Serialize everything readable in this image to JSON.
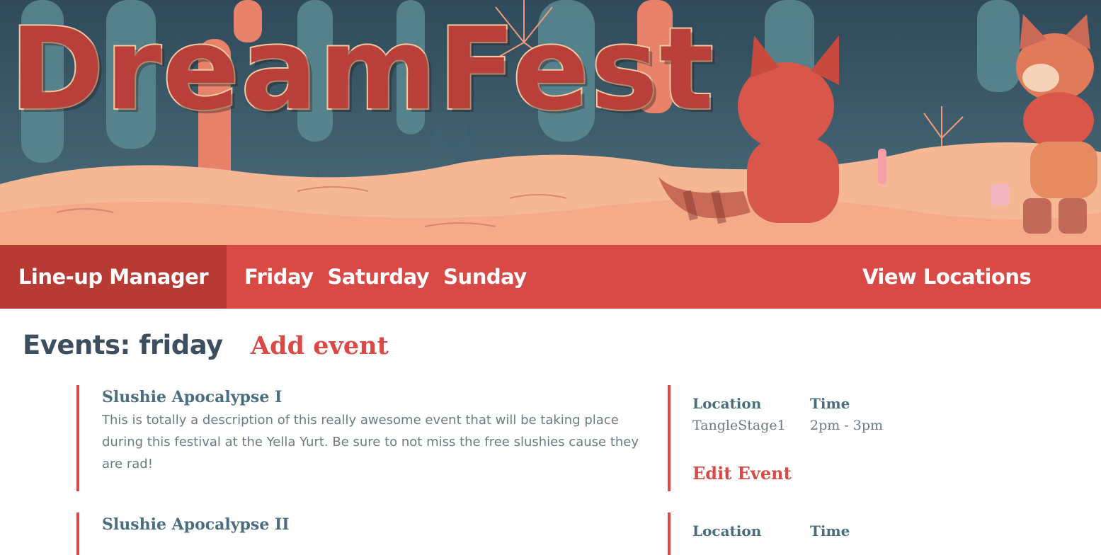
{
  "hero": {
    "logo_text": "DreamFest"
  },
  "nav": {
    "brand": "Line-up Manager",
    "days": [
      "Friday",
      "Saturday",
      "Sunday"
    ],
    "locations": "View Locations"
  },
  "page": {
    "title": "Events: friday",
    "add_event": "Add event"
  },
  "events": [
    {
      "title": "Slushie Apocalypse I",
      "description": "This is totally a description of this really awesome event that will be taking place during this festival at the Yella Yurt. Be sure to not miss the free slushies cause they are rad!",
      "location_label": "Location",
      "location": "TangleStage1",
      "time_label": "Time",
      "time": "2pm - 3pm",
      "edit": "Edit Event"
    },
    {
      "title": "Slushie Apocalypse II",
      "location_label": "Location",
      "time_label": "Time"
    }
  ],
  "colors": {
    "accent": "#d94a46",
    "accent_dark": "#b73a35",
    "heading": "#3d4f5e",
    "event_title": "#4a6e80",
    "body_text": "#6b7a85"
  }
}
